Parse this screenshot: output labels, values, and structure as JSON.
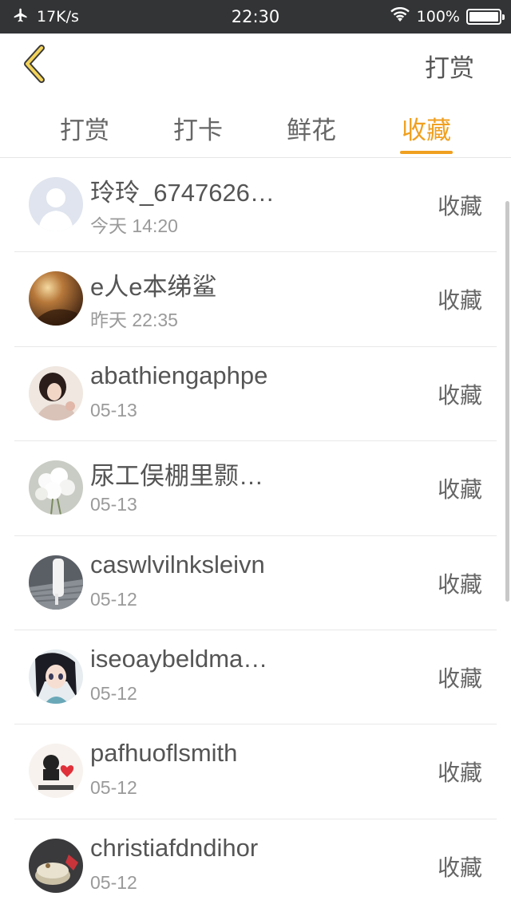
{
  "status_bar": {
    "speed": "17K/s",
    "time": "22:30",
    "battery": "100%",
    "icons": [
      "airplane-icon",
      "wifi-icon",
      "battery-icon"
    ]
  },
  "header": {
    "back_icon": "chevron-left-icon",
    "action_label": "打赏"
  },
  "tabs": [
    {
      "label": "打赏"
    },
    {
      "label": "打卡"
    },
    {
      "label": "鲜花"
    },
    {
      "label": "收藏",
      "active": true
    }
  ],
  "colors": {
    "accent": "#f0a020",
    "status_bar": "#333436"
  },
  "list": {
    "items": [
      {
        "name": "玲玲_6747626…",
        "time": "今天 14:20",
        "action": "收藏",
        "avatar": "default-user-avatar"
      },
      {
        "name": "e人e本绨鲨",
        "time": "昨天 22:35",
        "action": "收藏",
        "avatar": "sunset-photo-avatar"
      },
      {
        "name": "abathiengaphpe",
        "time": "05-13",
        "action": "收藏",
        "avatar": "girl-photo-avatar"
      },
      {
        "name": "尿工俣棚里颢…",
        "time": "05-13",
        "action": "收藏",
        "avatar": "white-flowers-avatar"
      },
      {
        "name": "caswlvilnksleivn",
        "time": "05-12",
        "action": "收藏",
        "avatar": "street-photo-avatar"
      },
      {
        "name": "iseoaybeldma…",
        "time": "05-12",
        "action": "收藏",
        "avatar": "anime-girl-avatar"
      },
      {
        "name": "pafhuoflsmith",
        "time": "05-12",
        "action": "收藏",
        "avatar": "cartoon-heart-avatar"
      },
      {
        "name": "christiafdndihor",
        "time": "05-12",
        "action": "收藏",
        "avatar": "cake-photo-avatar"
      }
    ]
  }
}
